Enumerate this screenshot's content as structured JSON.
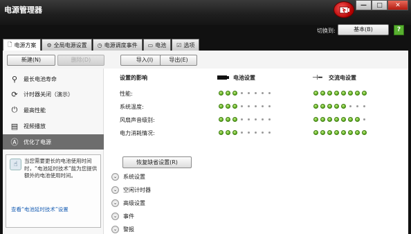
{
  "window": {
    "title": "电源管理器",
    "min_glyph": "—",
    "max_glyph": "□",
    "close_glyph": "✕"
  },
  "switch": {
    "label": "切换到:",
    "button": "基本(B)",
    "help_glyph": "?"
  },
  "tabs": [
    {
      "label": "电源方案",
      "icon": "document-icon"
    },
    {
      "label": "全局电源设置",
      "icon": "gear-icon"
    },
    {
      "label": "电源调度事件",
      "icon": "clock-icon"
    },
    {
      "label": "电池",
      "icon": "battery-icon"
    },
    {
      "label": "选项",
      "icon": "checkbox-icon"
    }
  ],
  "toolbar": {
    "new": "新建(N)",
    "delete": "删除(D)",
    "import": "导入(I)",
    "export": "导出(E)"
  },
  "sidebar": {
    "items": [
      {
        "label": "最长电池寿命",
        "icon": "battery-life-icon"
      },
      {
        "label": "计时器关闭（演示）",
        "icon": "timer-icon"
      },
      {
        "label": "最高性能",
        "icon": "power-icon"
      },
      {
        "label": "视频播放",
        "icon": "film-icon"
      },
      {
        "label": "优化了电源",
        "icon": "optimized-power-icon",
        "selected": true
      }
    ],
    "tip": {
      "text": "当您需要更长的电池使用时间时，“电池延时技术”能为您提供额外的电池使用时间。",
      "link": "查看“电池延时技术”设置"
    }
  },
  "main": {
    "header": "设置的影响",
    "battery_header": "电池设置",
    "ac_header": "交流电设置",
    "rows": [
      {
        "label": "性能:",
        "battery_on": 3,
        "ac_on": 8
      },
      {
        "label": "系统温度:",
        "battery_on": 3,
        "ac_on": 5
      },
      {
        "label": "风扇声音级别:",
        "battery_on": 3,
        "ac_on": 7
      },
      {
        "label": "电力消耗情况:",
        "battery_on": 3,
        "ac_on": 8
      }
    ],
    "dots_total": 8,
    "restore": "恢复缺省设置(R)",
    "sections": [
      "系统设置",
      "空闲计时器",
      "高级设置",
      "事件",
      "警报"
    ]
  },
  "colors": {
    "accent_green": "#55a81a",
    "selected_bg": "#6d6d6d",
    "link": "#1a5fb4"
  }
}
